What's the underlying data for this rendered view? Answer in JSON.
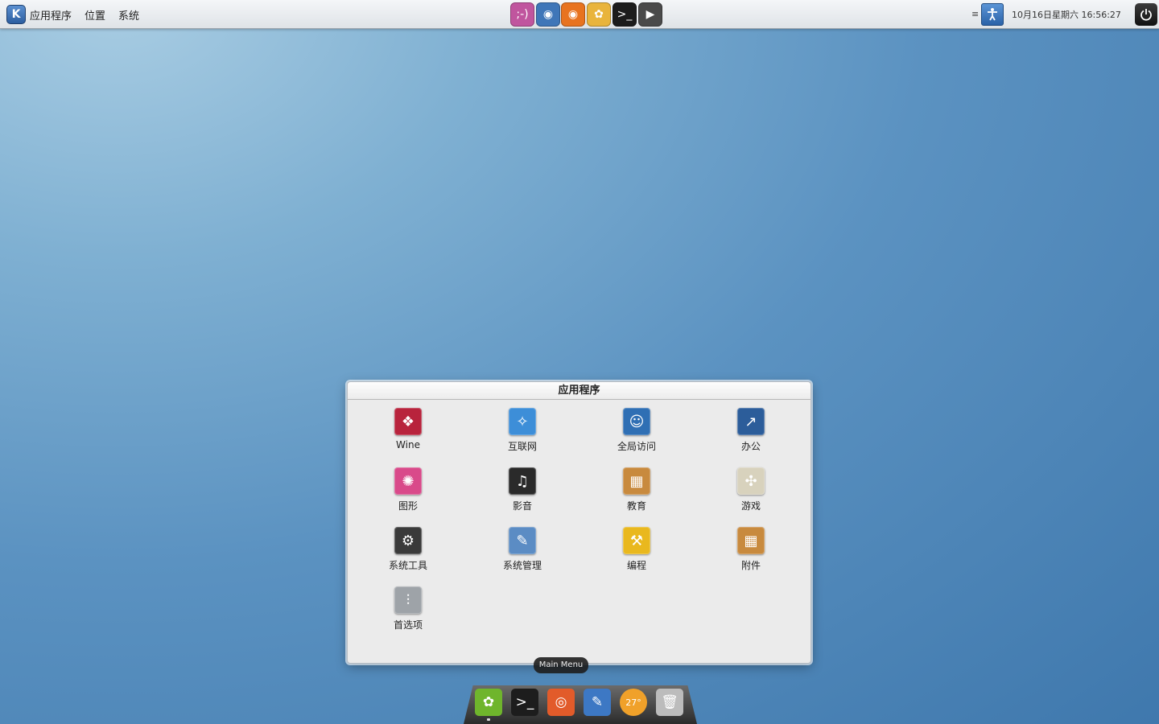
{
  "top_panel": {
    "menu_applications": "应用程序",
    "menu_places": "位置",
    "menu_system": "系统",
    "logo_text": "K",
    "launchers": [
      {
        "name": "chat-icon",
        "glyph": ";-)",
        "color": "#c0559e"
      },
      {
        "name": "browser-icon",
        "glyph": "◉",
        "color": "#3f76b8"
      },
      {
        "name": "eye-icon",
        "glyph": "◉",
        "color": "#e8731f"
      },
      {
        "name": "paint-icon",
        "glyph": "✿",
        "color": "#e9b43c"
      },
      {
        "name": "terminal-icon",
        "glyph": ">_",
        "color": "#1c1c1c"
      },
      {
        "name": "media-player-icon",
        "glyph": "▶",
        "color": "#4a4a4a"
      }
    ],
    "clock": "10月16日星期六 16:56:27",
    "menu_lines": "≡"
  },
  "apps_window": {
    "title": "应用程序",
    "items": [
      {
        "label": "Wine",
        "icon": "wine-icon",
        "glyph": "❖",
        "color": "#b8233c"
      },
      {
        "label": "互联网",
        "icon": "internet-icon",
        "glyph": "✧",
        "color": "#3d8ed8"
      },
      {
        "label": "全局访问",
        "icon": "accessibility-icon",
        "glyph": "☺",
        "color": "#2f6fb4"
      },
      {
        "label": "办公",
        "icon": "office-icon",
        "glyph": "↗",
        "color": "#2c5d9a"
      },
      {
        "label": "图形",
        "icon": "graphics-icon",
        "glyph": "✺",
        "color": "#d94a8a"
      },
      {
        "label": "影音",
        "icon": "multimedia-icon",
        "glyph": "♫",
        "color": "#2a2a2a"
      },
      {
        "label": "教育",
        "icon": "education-icon",
        "glyph": "▦",
        "color": "#c88a3e"
      },
      {
        "label": "游戏",
        "icon": "games-icon",
        "glyph": "✣",
        "color": "#d8d2bd"
      },
      {
        "label": "系统工具",
        "icon": "system-tools-icon",
        "glyph": "⚙",
        "color": "#3a3a3a"
      },
      {
        "label": "系统管理",
        "icon": "administration-icon",
        "glyph": "✎",
        "color": "#5b8cc4"
      },
      {
        "label": "编程",
        "icon": "programming-icon",
        "glyph": "⚒",
        "color": "#e9b81e"
      },
      {
        "label": "附件",
        "icon": "accessories-icon",
        "glyph": "▦",
        "color": "#c88a3e"
      },
      {
        "label": "首选项",
        "icon": "preferences-icon",
        "glyph": "⫶",
        "color": "#9ea3a8"
      }
    ]
  },
  "tooltip": "Main Menu",
  "dock": [
    {
      "name": "main-menu-icon",
      "glyph": "✿",
      "color": "#6fb52c"
    },
    {
      "name": "terminal-dock-icon",
      "glyph": ">_",
      "color": "#1d1d1d"
    },
    {
      "name": "ubuntu-icon",
      "glyph": "◎",
      "color": "#e25b2a"
    },
    {
      "name": "desktop-icon",
      "glyph": "✎",
      "color": "#3d78c4"
    },
    {
      "name": "weather-icon",
      "glyph": "27°",
      "color": "#f0a12a"
    },
    {
      "name": "trash-icon",
      "glyph": "🗑",
      "color": "#bcbcbc"
    }
  ]
}
